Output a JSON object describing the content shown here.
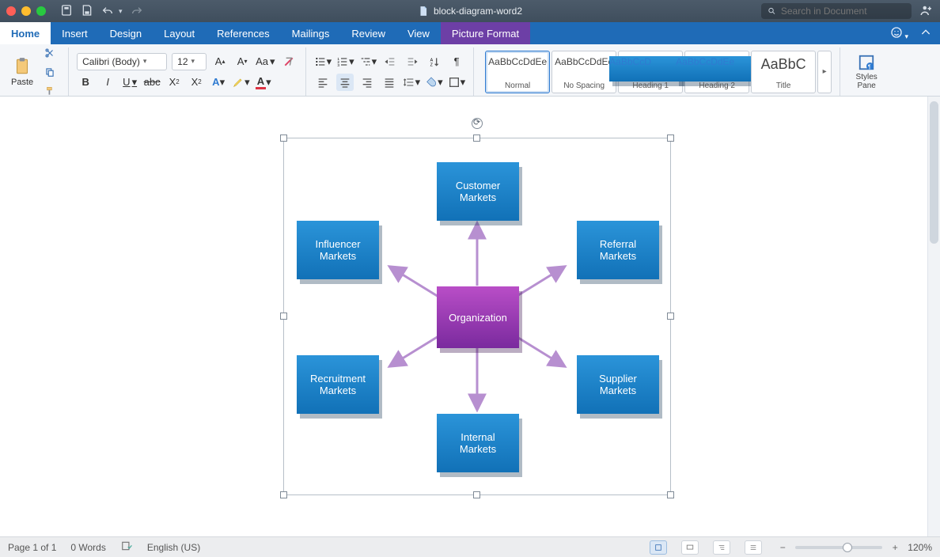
{
  "titlebar": {
    "doc_name": "block-diagram-word2",
    "search_placeholder": "Search in Document"
  },
  "tabs": {
    "items": [
      "Home",
      "Insert",
      "Design",
      "Layout",
      "References",
      "Mailings",
      "Review",
      "View",
      "Picture Format"
    ],
    "active_index": 0,
    "context_index": 8
  },
  "ribbon": {
    "paste_label": "Paste",
    "font_name": "Calibri (Body)",
    "font_size": "12",
    "styles": [
      {
        "preview": "AaBbCcDdEe",
        "label": "Normal",
        "blue": false,
        "big": false,
        "selected": true
      },
      {
        "preview": "AaBbCcDdEe",
        "label": "No Spacing",
        "blue": false,
        "big": false,
        "selected": false
      },
      {
        "preview": "AaBbCcD",
        "label": "Heading 1",
        "blue": true,
        "big": false,
        "selected": false
      },
      {
        "preview": "AaBbCcDdEe",
        "label": "Heading 2",
        "blue": true,
        "big": false,
        "selected": false
      },
      {
        "preview": "AaBbC",
        "label": "Title",
        "blue": false,
        "big": true,
        "selected": false
      }
    ],
    "styles_pane_label": "Styles Pane"
  },
  "diagram": {
    "center": "Organization",
    "nodes": {
      "top": "Customer Markets",
      "tl": "Influencer Markets",
      "tr": "Referral Markets",
      "bl": "Recruitment Markets",
      "br": "Supplier Markets",
      "bottom": "Internal Markets"
    }
  },
  "status": {
    "page": "Page 1 of 1",
    "words": "0 Words",
    "lang": "English (US)",
    "zoom": "120%"
  }
}
